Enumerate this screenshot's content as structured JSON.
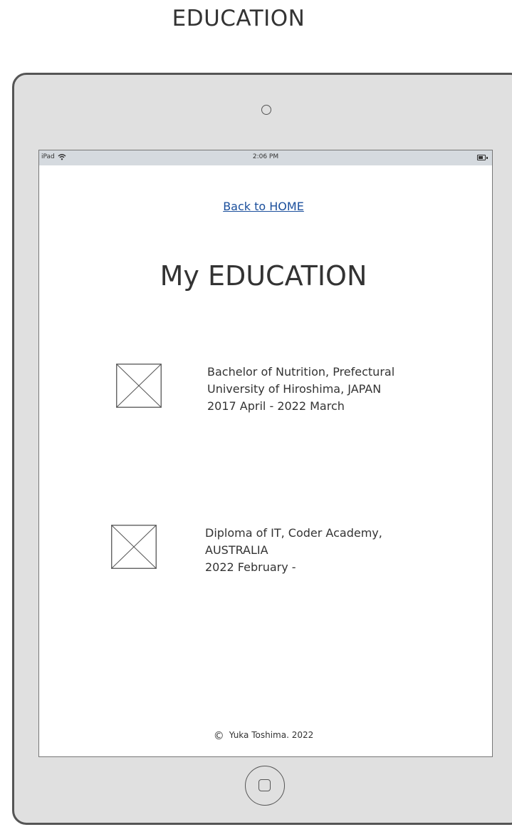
{
  "page_heading": "EDUCATION",
  "status_bar": {
    "device": "iPad",
    "time": "2:06 PM"
  },
  "nav": {
    "back_link": "Back to HOME"
  },
  "main": {
    "title": "My EDUCATION",
    "education": [
      {
        "lines": [
          "Bachelor of Nutrition, Prefectural",
          "University of Hiroshima, JAPAN",
          "2017 April - 2022 March"
        ]
      },
      {
        "lines": [
          "Diploma of IT, Coder Academy,",
          "AUSTRALIA",
          "2022 February -"
        ]
      }
    ]
  },
  "footer": {
    "copyright_symbol": "©",
    "text": "Yuka Toshima. 2022"
  },
  "icons": {
    "wifi": "wifi-icon",
    "battery": "battery-icon",
    "camera": "camera-icon",
    "home": "home-button-icon",
    "image_placeholder": "image-placeholder-icon"
  },
  "colors": {
    "link": "#1b4f9c",
    "frame": "#e0e0e0",
    "status_bar": "#d5dadf"
  }
}
